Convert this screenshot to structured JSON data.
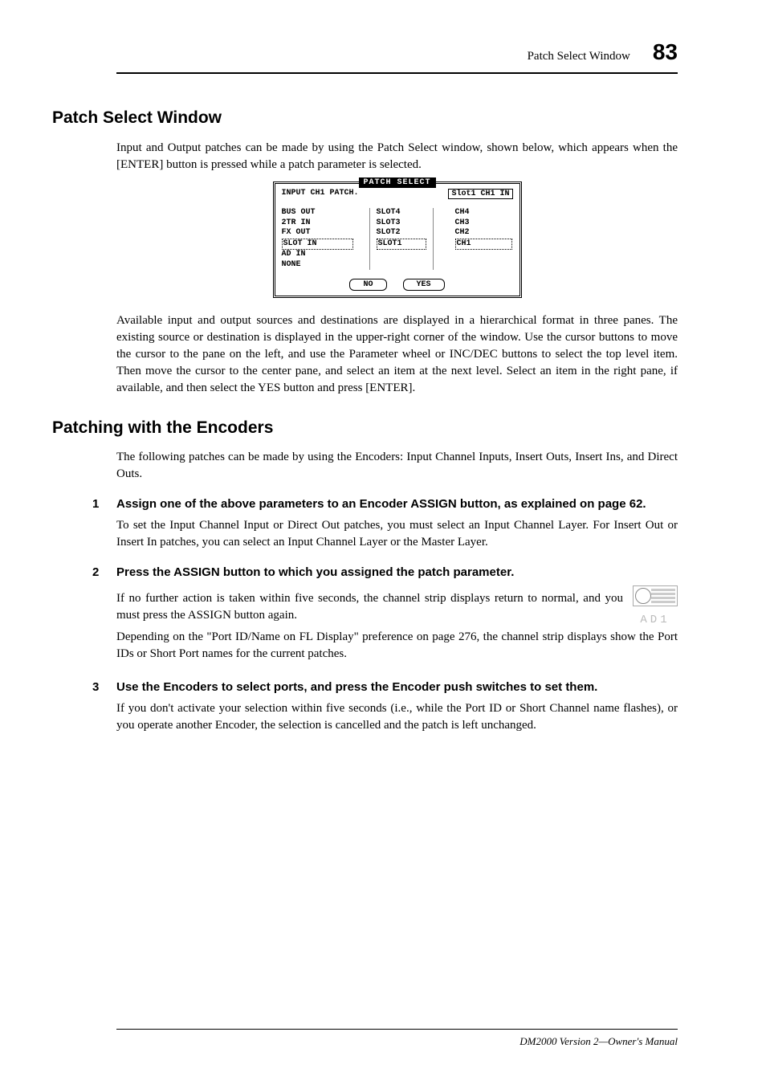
{
  "header": {
    "chapter": "Patch Select Window",
    "page": "83"
  },
  "section1": {
    "heading": "Patch Select Window",
    "intro": "Input and Output patches can be made by using the Patch Select window, shown below, which appears when the [ENTER] button is pressed while a patch parameter is selected.",
    "para2": "Available input and output sources and destinations are displayed in a hierarchical format in three panes. The existing source or destination is displayed in the upper-right corner of the window. Use the cursor buttons to move the cursor to the pane on the left, and use the Parameter wheel or INC/DEC buttons to select the top level item. Then move the cursor to the center pane, and select an item at the next level. Select an item in the right pane, if available, and then select the YES button and press [ENTER]."
  },
  "patch_window": {
    "title": "PATCH SELECT",
    "subtitle": "INPUT CH1 PATCH.",
    "current": "Slot1 CH1 IN",
    "left_pane": [
      "BUS OUT",
      "2TR IN",
      "FX OUT",
      "SLOT IN",
      "AD IN",
      "NONE"
    ],
    "left_selected_index": 3,
    "mid_pane": [
      "SLOT4",
      "SLOT3",
      "SLOT2",
      "SLOT1"
    ],
    "mid_selected_index": 3,
    "right_pane": [
      "CH4",
      "CH3",
      "CH2",
      "CH1"
    ],
    "right_selected_index": 3,
    "no_label": "NO",
    "yes_label": "YES"
  },
  "section2": {
    "heading": "Patching with the Encoders",
    "intro": "The following patches can be made by using the Encoders: Input Channel Inputs, Insert Outs, Insert Ins, and Direct Outs.",
    "steps": {
      "s1": {
        "num": "1",
        "heading": "Assign one of the above parameters to an Encoder ASSIGN button, as explained on page 62.",
        "body": "To set the Input Channel Input or Direct Out patches, you must select an Input Channel Layer. For Insert Out or Insert In patches, you can select an Input Channel Layer or the Master Layer."
      },
      "s2": {
        "num": "2",
        "heading": "Press the ASSIGN button to which you assigned the patch parameter.",
        "body1": "If no further action is taken within five seconds, the channel strip displays return to normal, and you must press the ASSIGN button again.",
        "body2": "Depending on the \"Port ID/Name on FL Display\" preference on page 276, the channel strip displays show the Port IDs or Short Port names for the current patches.",
        "encoder_label": "AD1"
      },
      "s3": {
        "num": "3",
        "heading": "Use the Encoders to select ports, and press the Encoder push switches to set them.",
        "body": "If you don't activate your selection within five seconds (i.e., while the Port ID or Short Channel name flashes), or you operate another Encoder, the selection is cancelled and the patch is left unchanged."
      }
    }
  },
  "footer": {
    "text": "DM2000 Version 2—Owner's Manual"
  }
}
